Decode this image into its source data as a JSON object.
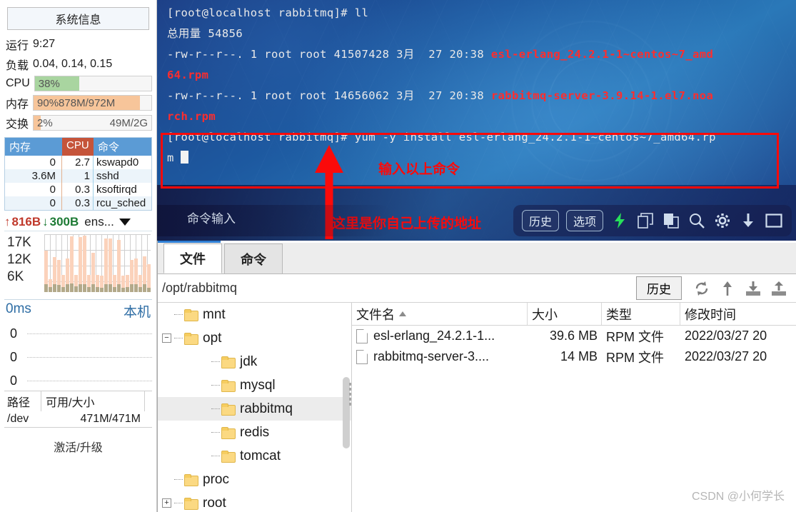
{
  "monitor": {
    "sysinfo_button": "系统信息",
    "uptime_label": "运行",
    "uptime_value": "9:27",
    "load_label": "负载",
    "load_value": "0.04, 0.14, 0.15",
    "cpu_label": "CPU",
    "cpu_percent_text": "38%",
    "cpu_percent": 38,
    "cpu_bar_color": "#a9d5a0",
    "mem_label": "内存",
    "mem_percent_text": "90%",
    "mem_value_text": "878M/972M",
    "mem_percent": 90,
    "mem_bar_color": "#f7c59a",
    "swap_label": "交换",
    "swap_percent_text": "2%",
    "swap_value_text": "49M/2G",
    "swap_percent": 6,
    "swap_bar_color": "#f7c59a",
    "proc_headers": [
      "内存",
      "CPU",
      "命令"
    ],
    "proc_rows": [
      {
        "mem": "0",
        "cpu": "2.7",
        "cmd": "kswapd0"
      },
      {
        "mem": "3.6M",
        "cpu": "1",
        "cmd": "sshd"
      },
      {
        "mem": "0",
        "cpu": "0.3",
        "cmd": "ksoftirqd"
      },
      {
        "mem": "0",
        "cpu": "0.3",
        "cmd": "rcu_sched"
      }
    ],
    "net_up": "816B",
    "net_down": "300B",
    "net_iface": "ens...",
    "graph_y_labels": [
      "17K",
      "12K",
      "6K"
    ],
    "graph_bars": [
      72,
      22,
      60,
      55,
      30,
      58,
      96,
      30,
      95,
      97,
      30,
      68,
      30,
      28,
      93,
      92,
      30,
      90,
      28,
      30,
      55,
      58,
      30,
      62,
      48
    ],
    "graph_bars_base": [
      14,
      9,
      13,
      12,
      9,
      13,
      15,
      10,
      14,
      14,
      9,
      14,
      9,
      8,
      13,
      13,
      9,
      14,
      8,
      9,
      13,
      13,
      9,
      14,
      7
    ],
    "latency_value": "0ms",
    "latency_host": "本机",
    "latency_rows": [
      "0",
      "0",
      "0"
    ],
    "disk_headers": [
      "路径",
      "可用/大小",
      ""
    ],
    "disk_rows": [
      {
        "path": "/dev",
        "free_size": "471M/471M"
      }
    ],
    "activate_text": "激活/升级"
  },
  "terminal": {
    "lines": [
      {
        "segments": [
          {
            "text": "[root@localhost rabbitmq]# ll",
            "color": "white"
          }
        ]
      },
      {
        "segments": [
          {
            "text": "总用量 54856",
            "color": "white"
          }
        ]
      },
      {
        "segments": [
          {
            "text": "-rw-r--r--. 1 root root 41507428 3月  27 20:38 ",
            "color": "white"
          },
          {
            "text": "esl-erlang_24.2.1-1~centos~7_amd",
            "color": "red"
          }
        ]
      },
      {
        "segments": [
          {
            "text": "64.rpm",
            "color": "red"
          }
        ]
      },
      {
        "segments": [
          {
            "text": "-rw-r--r--. 1 root root 14656062 3月  27 20:38 ",
            "color": "white"
          },
          {
            "text": "rabbitmq-server-3.9.14-1.el7.noa",
            "color": "red"
          }
        ]
      },
      {
        "segments": [
          {
            "text": "rch.rpm",
            "color": "red"
          }
        ]
      },
      {
        "segments": [
          {
            "text": "[root@localhost rabbitmq]# yum -y install esl-erlang_24.2.1-1~centos~7_amd64.rp",
            "color": "white"
          }
        ]
      },
      {
        "segments": [
          {
            "text": "m ",
            "color": "white"
          }
        ]
      }
    ],
    "annotations": {
      "box_color": "#fb0a0a",
      "note_top": "输入以上命令",
      "note_bottom": "这里是你自己上传的地址"
    },
    "command_input_placeholder": "命令输入",
    "buttons": {
      "history": "历史",
      "options": "选项"
    },
    "icons": [
      "lightning-icon",
      "copy-icon",
      "paste-icon",
      "search-icon",
      "gear-icon",
      "download-icon",
      "window-icon"
    ]
  },
  "filemanager": {
    "tabs": [
      {
        "label": "文件",
        "active": true
      },
      {
        "label": "命令",
        "active": false
      }
    ],
    "path": "/opt/rabbitmq",
    "history_button": "历史",
    "toolbar_icons": [
      "refresh-icon",
      "upload-arrow-icon",
      "download-file-icon",
      "upload-file-icon"
    ],
    "tree": [
      {
        "label": "mnt",
        "depth": 1,
        "expander": "",
        "selected": false
      },
      {
        "label": "opt",
        "depth": 1,
        "expander": "-",
        "selected": false
      },
      {
        "label": "jdk",
        "depth": 2,
        "expander": "",
        "selected": false
      },
      {
        "label": "mysql",
        "depth": 2,
        "expander": "",
        "selected": false
      },
      {
        "label": "rabbitmq",
        "depth": 2,
        "expander": "",
        "selected": true
      },
      {
        "label": "redis",
        "depth": 2,
        "expander": "",
        "selected": false
      },
      {
        "label": "tomcat",
        "depth": 2,
        "expander": "",
        "selected": false
      },
      {
        "label": "proc",
        "depth": 1,
        "expander": "",
        "selected": false
      },
      {
        "label": "root",
        "depth": 1,
        "expander": "+",
        "selected": false
      }
    ],
    "list_headers": [
      "文件名",
      "大小",
      "类型",
      "修改时间"
    ],
    "list_rows": [
      {
        "name": "esl-erlang_24.2.1-1...",
        "size": "39.6 MB",
        "type": "RPM 文件",
        "mtime": "2022/03/27 20"
      },
      {
        "name": "rabbitmq-server-3....",
        "size": "14 MB",
        "type": "RPM 文件",
        "mtime": "2022/03/27 20"
      }
    ],
    "watermark": "CSDN @小何学长"
  }
}
